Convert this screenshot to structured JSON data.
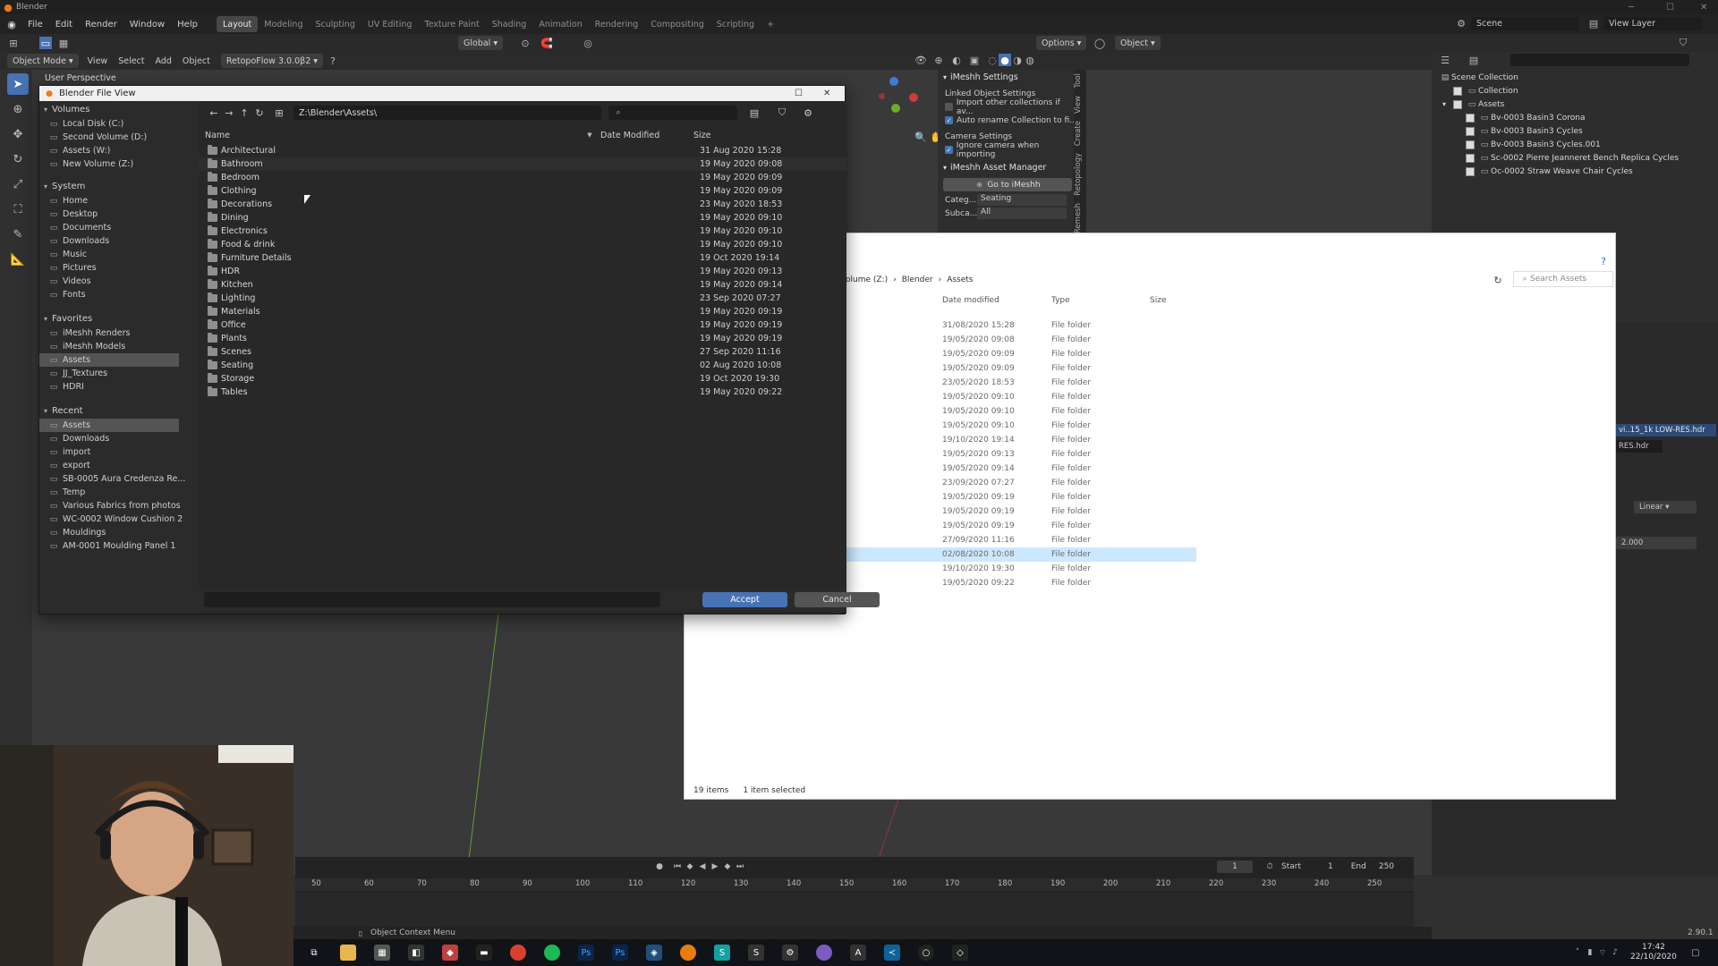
{
  "app": {
    "window_title": "Blender",
    "menu": [
      "File",
      "Edit",
      "Render",
      "Window",
      "Help"
    ],
    "workspaces": [
      "Layout",
      "Modeling",
      "Sculpting",
      "UV Editing",
      "Texture Paint",
      "Shading",
      "Animation",
      "Rendering",
      "Compositing",
      "Scripting"
    ],
    "active_workspace": "Layout",
    "scene_label": "Scene",
    "view_layer_label": "View Layer"
  },
  "toolbar": {
    "global": "Global",
    "options": "Options",
    "object": "Object"
  },
  "header": {
    "mode": "Object Mode",
    "view": "View",
    "select": "Select",
    "add": "Add",
    "object": "Object",
    "addon": "RetopoFlow 3.0.0β2"
  },
  "viewport": {
    "label": "User Perspective"
  },
  "file_dialog": {
    "title": "Blender File View",
    "path": "Z:\\Blender\\Assets\\",
    "search_placeholder": "",
    "columns": {
      "name": "Name",
      "date": "Date Modified",
      "size": "Size"
    },
    "volumes_title": "Volumes",
    "volumes": [
      "Local Disk (C:)",
      "Second Volume (D:)",
      "Assets (W:)",
      "New Volume (Z:)"
    ],
    "system_title": "System",
    "system": [
      "Home",
      "Desktop",
      "Documents",
      "Downloads",
      "Music",
      "Pictures",
      "Videos",
      "Fonts"
    ],
    "favorites_title": "Favorites",
    "favorites": [
      "iMeshh Renders",
      "iMeshh Models",
      "Assets",
      "JJ_Textures",
      "HDRI"
    ],
    "recent_title": "Recent",
    "recent": [
      "Assets",
      "Downloads",
      "import",
      "export",
      "SB-0005 Aura Credenza Re...",
      "Temp",
      "Various Fabrics from photos",
      "WC-0002 Window Cushion 2",
      "Mouldings",
      "AM-0001 Moulding Panel 1"
    ],
    "files": [
      {
        "name": "Architectural",
        "date": "31 Aug 2020 15:28"
      },
      {
        "name": "Bathroom",
        "date": "19 May 2020 09:08"
      },
      {
        "name": "Bedroom",
        "date": "19 May 2020 09:09"
      },
      {
        "name": "Clothing",
        "date": "19 May 2020 09:09"
      },
      {
        "name": "Decorations",
        "date": "23 May 2020 18:53"
      },
      {
        "name": "Dining",
        "date": "19 May 2020 09:10"
      },
      {
        "name": "Electronics",
        "date": "19 May 2020 09:10"
      },
      {
        "name": "Food & drink",
        "date": "19 May 2020 09:10"
      },
      {
        "name": "Furniture Details",
        "date": "19 Oct 2020 19:14"
      },
      {
        "name": "HDR",
        "date": "19 May 2020 09:13"
      },
      {
        "name": "Kitchen",
        "date": "19 May 2020 09:14"
      },
      {
        "name": "Lighting",
        "date": "23 Sep 2020 07:27"
      },
      {
        "name": "Materials",
        "date": "19 May 2020 09:19"
      },
      {
        "name": "Office",
        "date": "19 May 2020 09:19"
      },
      {
        "name": "Plants",
        "date": "19 May 2020 09:19"
      },
      {
        "name": "Scenes",
        "date": "27 Sep 2020 11:16"
      },
      {
        "name": "Seating",
        "date": "02 Aug 2020 10:08"
      },
      {
        "name": "Storage",
        "date": "19 Oct 2020 19:30"
      },
      {
        "name": "Tables",
        "date": "19 May 2020 09:22"
      }
    ],
    "accept": "Accept",
    "cancel": "Cancel"
  },
  "npanel": {
    "settings_title": "iMeshh Settings",
    "linked_title": "Linked Object Settings",
    "import_other": "Import other collections if av...",
    "auto_rename": "Auto rename Collection to fi...",
    "camera_title": "Camera Settings",
    "ignore_camera": "Ignore camera when importing",
    "asset_manager": "iMeshh Asset Manager",
    "go_button": "Go to iMeshh",
    "category_label": "Categ...",
    "category_value": "Seating",
    "subcat_label": "Subca...",
    "subcat_value": "All",
    "tabs": [
      "Tool",
      "View",
      "Create",
      "Retopology",
      "Remesh"
    ]
  },
  "outliner": {
    "title": "Scene Collection",
    "items": [
      "Collection",
      "Assets",
      "Bv-0003 Basin3 Corona",
      "Bv-0003 Basin3 Cycles",
      "Bv-0003 Basin3 Cycles.001",
      "Sc-0002 Pierre Jeanneret Bench Replica Cycles",
      "Oc-0002 Straw Weave Chair Cycles"
    ]
  },
  "properties": {
    "hdr1": "vi..15_1k LOW-RES.hdr",
    "hdr2": "RES.hdr",
    "interp": "Linear",
    "value": "2.000"
  },
  "explorer": {
    "breadcrumb": [
      "olume (Z:)",
      "Blender",
      "Assets"
    ],
    "search_placeholder": "Search Assets",
    "columns": [
      "Date modified",
      "Type",
      "Size"
    ],
    "type_text": "File folder",
    "dates": [
      "31/08/2020 15:28",
      "19/05/2020 09:08",
      "19/05/2020 09:09",
      "19/05/2020 09:09",
      "23/05/2020 18:53",
      "19/05/2020 09:10",
      "19/05/2020 09:10",
      "19/05/2020 09:10",
      "19/10/2020 19:14",
      "19/05/2020 09:13",
      "19/05/2020 09:14",
      "23/09/2020 07:27",
      "19/05/2020 09:19",
      "19/05/2020 09:19",
      "19/05/2020 09:19",
      "27/09/2020 11:16",
      "02/08/2020 10:08",
      "19/10/2020 19:30",
      "19/05/2020 09:22"
    ],
    "selected_index": 16,
    "status_count": "19 items",
    "status_selected": "1 item selected"
  },
  "timeline": {
    "ticks": [
      "50",
      "60",
      "70",
      "80",
      "90",
      "100",
      "110",
      "120",
      "130",
      "140",
      "150",
      "160",
      "170",
      "180",
      "190",
      "200",
      "210",
      "220",
      "230",
      "240",
      "250"
    ],
    "current": "1",
    "start_label": "Start",
    "start": "1",
    "end_label": "End",
    "end": "250"
  },
  "statusbar": {
    "context": "Object Context Menu",
    "version": "2.90.1"
  },
  "taskbar": {
    "time": "17:42",
    "date": "22/10/2020"
  },
  "colors": {
    "accent": "#4772b3",
    "background": "#303030",
    "selected_row": "#545454"
  }
}
